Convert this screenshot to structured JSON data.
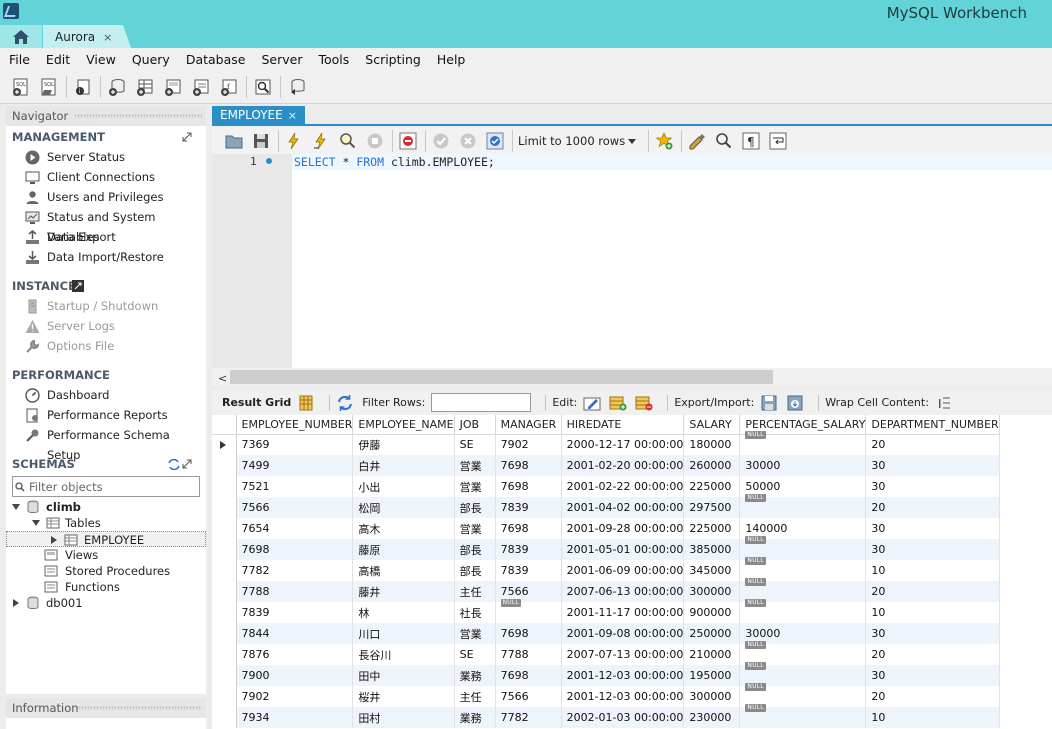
{
  "window": {
    "app_title": "MySQL Workbench",
    "connection_tab": "Aurora",
    "close_glyph": "×"
  },
  "menu": [
    "File",
    "Edit",
    "View",
    "Query",
    "Database",
    "Server",
    "Tools",
    "Scripting",
    "Help"
  ],
  "navigator": {
    "header": "Navigator",
    "management": {
      "title": "MANAGEMENT",
      "items": [
        "Server Status",
        "Client Connections",
        "Users and Privileges",
        "Status and System Variables",
        "Data Export",
        "Data Import/Restore"
      ]
    },
    "instance": {
      "title": "INSTANCE",
      "items": [
        "Startup / Shutdown",
        "Server Logs",
        "Options File"
      ]
    },
    "performance": {
      "title": "PERFORMANCE",
      "items": [
        "Dashboard",
        "Performance Reports",
        "Performance Schema Setup"
      ]
    },
    "schemas": {
      "title": "SCHEMAS",
      "filter_placeholder": "Filter objects",
      "tree": {
        "schema1": "climb",
        "tables": "Tables",
        "table1": "EMPLOYEE",
        "views": "Views",
        "procedures": "Stored Procedures",
        "functions": "Functions",
        "schema2": "db001"
      }
    },
    "information": "Information"
  },
  "editor": {
    "tab_label": "EMPLOYEE",
    "limit_label": "Limit to 1000 rows",
    "line_number": "1",
    "sql": {
      "kw1": "SELECT",
      "mid": " * ",
      "kw2": "FROM",
      "rest": " climb.EMPLOYEE;"
    }
  },
  "result_toolbar": {
    "grid_label": "Result Grid",
    "filter_label": "Filter Rows:",
    "edit_label": "Edit:",
    "export_label": "Export/Import:",
    "wrap_label": "Wrap Cell Content:"
  },
  "result_grid": {
    "null_text": "NULL",
    "columns": [
      "EMPLOYEE_NUMBER",
      "EMPLOYEE_NAME",
      "JOB",
      "MANAGER",
      "HIREDATE",
      "SALARY",
      "PERCENTAGE_SALARY",
      "DEPARTMENT_NUMBER"
    ],
    "rows": [
      [
        "7369",
        "伊藤",
        "SE",
        "7902",
        "2000-12-17 00:00:00",
        "180000",
        null,
        "20"
      ],
      [
        "7499",
        "白井",
        "営業",
        "7698",
        "2001-02-20 00:00:00",
        "260000",
        "30000",
        "30"
      ],
      [
        "7521",
        "小出",
        "営業",
        "7698",
        "2001-02-22 00:00:00",
        "225000",
        "50000",
        "30"
      ],
      [
        "7566",
        "松岡",
        "部長",
        "7839",
        "2001-04-02 00:00:00",
        "297500",
        null,
        "20"
      ],
      [
        "7654",
        "高木",
        "営業",
        "7698",
        "2001-09-28 00:00:00",
        "225000",
        "140000",
        "30"
      ],
      [
        "7698",
        "藤原",
        "部長",
        "7839",
        "2001-05-01 00:00:00",
        "385000",
        null,
        "30"
      ],
      [
        "7782",
        "高橋",
        "部長",
        "7839",
        "2001-06-09 00:00:00",
        "345000",
        null,
        "10"
      ],
      [
        "7788",
        "藤井",
        "主任",
        "7566",
        "2007-06-13 00:00:00",
        "300000",
        null,
        "20"
      ],
      [
        "7839",
        "林",
        "社長",
        null,
        "2001-11-17 00:00:00",
        "900000",
        null,
        "10"
      ],
      [
        "7844",
        "川口",
        "営業",
        "7698",
        "2001-09-08 00:00:00",
        "250000",
        "30000",
        "30"
      ],
      [
        "7876",
        "長谷川",
        "SE",
        "7788",
        "2007-07-13 00:00:00",
        "210000",
        null,
        "20"
      ],
      [
        "7900",
        "田中",
        "業務",
        "7698",
        "2001-12-03 00:00:00",
        "195000",
        null,
        "30"
      ],
      [
        "7902",
        "桜井",
        "主任",
        "7566",
        "2001-12-03 00:00:00",
        "300000",
        null,
        "20"
      ],
      [
        "7934",
        "田村",
        "業務",
        "7782",
        "2002-01-03 00:00:00",
        "230000",
        null,
        "10"
      ]
    ]
  },
  "colors": {
    "titlebar": "#62d4d7",
    "tab_active": "#2a8ec7",
    "keyword": "#2a73c9",
    "row_alt": "#eef4fb"
  }
}
